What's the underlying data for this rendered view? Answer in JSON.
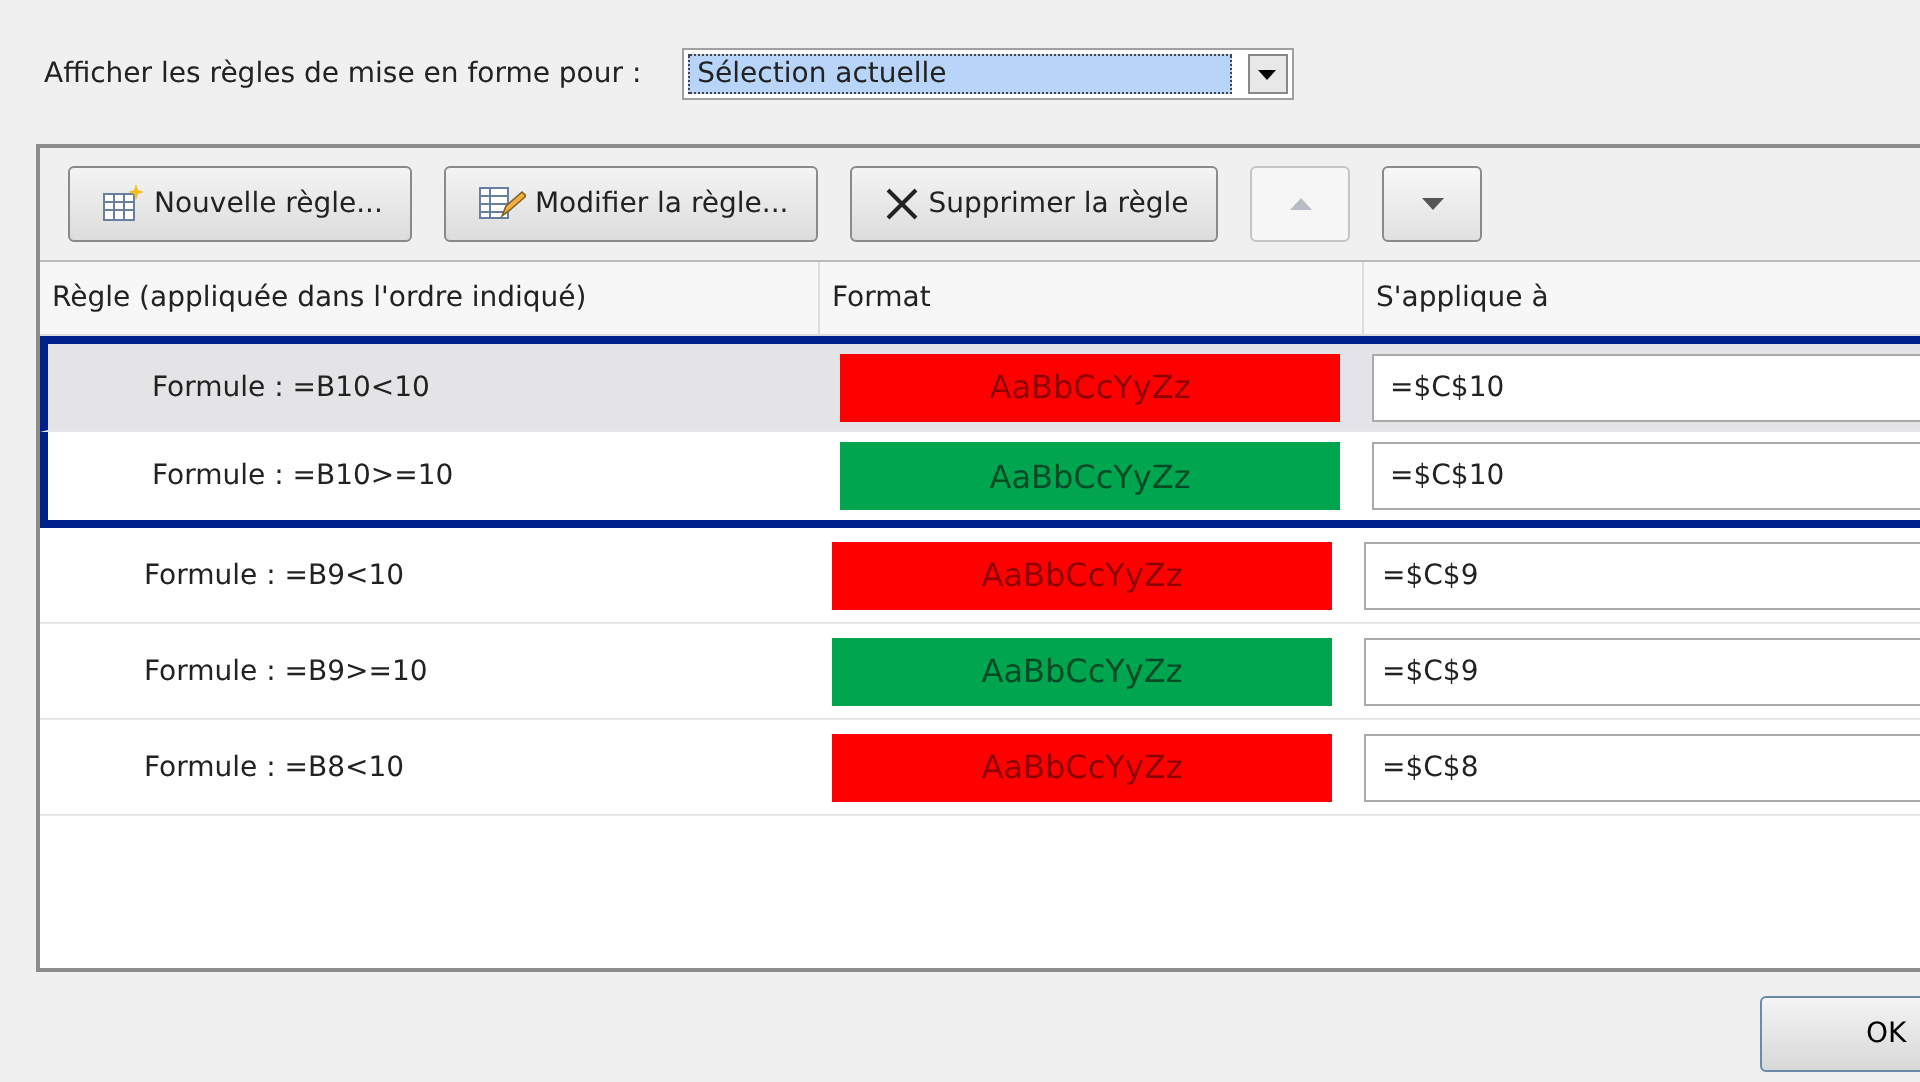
{
  "show_rules_for": {
    "label": "Afficher les règles de mise en forme pour :",
    "value": "Sélection actuelle"
  },
  "toolbar": [
    {
      "kind": "new",
      "label": "Nouvelle règle...",
      "disabled": false
    },
    {
      "kind": "edit",
      "label": "Modifier la règle...",
      "disabled": false
    },
    {
      "kind": "delete",
      "label": "Supprimer la règle",
      "disabled": false
    },
    {
      "kind": "up",
      "disabled": true
    },
    {
      "kind": "down",
      "disabled": false
    }
  ],
  "table": {
    "columns": [
      "Règle (appliquée dans l'ordre indiqué)",
      "Format",
      "S'applique à"
    ],
    "rows": [
      {
        "rule": "Formule : =B10<10",
        "preview": "AaBbCcYyZz",
        "color": "#ff0000",
        "applies_to": "=$C$10",
        "selected": true,
        "outlined": true
      },
      {
        "rule": "Formule : =B10>=10",
        "preview": "AaBbCcYyZz",
        "color": "#00a550",
        "applies_to": "=$C$10",
        "selected": false,
        "outlined": true
      },
      {
        "rule": "Formule : =B9<10",
        "preview": "AaBbCcYyZz",
        "color": "#ff0000",
        "applies_to": "=$C$9",
        "selected": false,
        "outlined": false
      },
      {
        "rule": "Formule : =B9>=10",
        "preview": "AaBbCcYyZz",
        "color": "#00a550",
        "applies_to": "=$C$9",
        "selected": false,
        "outlined": false
      },
      {
        "rule": "Formule : =B8<10",
        "preview": "AaBbCcYyZz",
        "color": "#ff0000",
        "applies_to": "=$C$8",
        "selected": false,
        "outlined": false
      }
    ]
  },
  "buttons": [
    "OK"
  ]
}
